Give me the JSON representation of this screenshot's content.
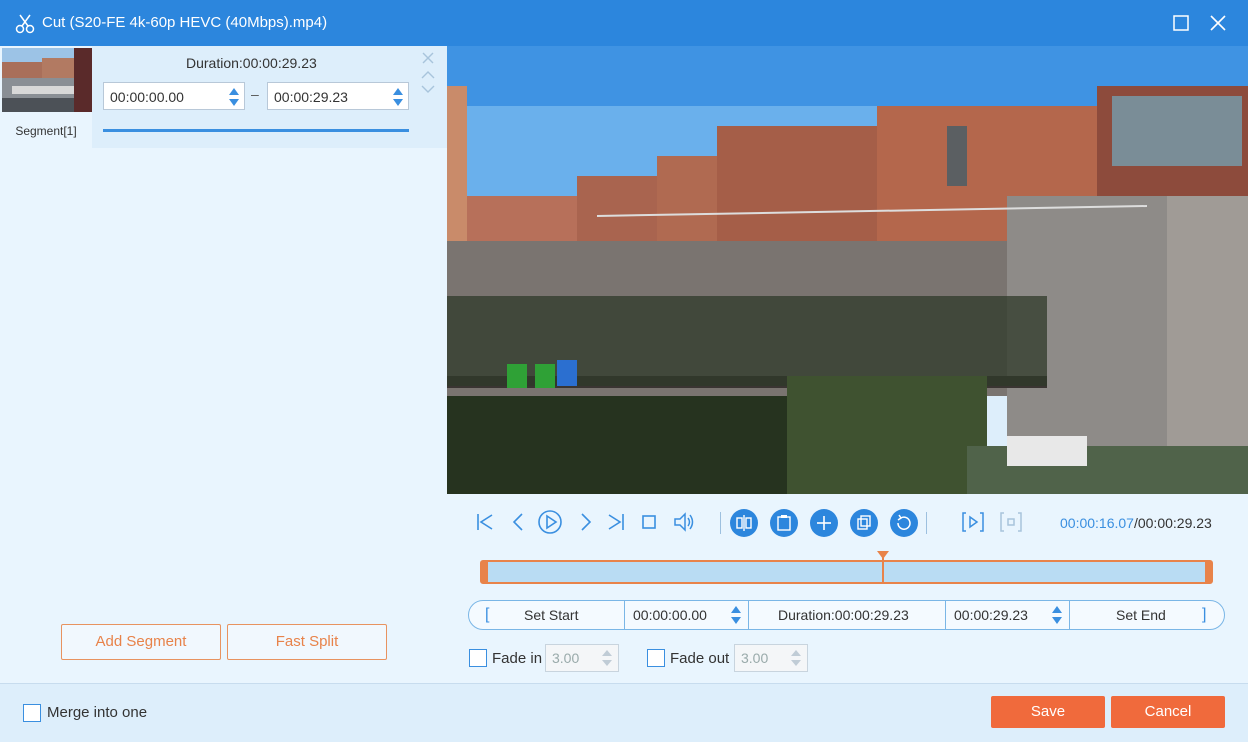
{
  "window": {
    "title": "Cut (S20-FE 4k-60p HEVC (40Mbps).mp4)"
  },
  "segment": {
    "label": "Segment[1]",
    "duration": "Duration:00:00:29.23",
    "start": "00:00:00.00",
    "end": "00:00:29.23",
    "dash": "–"
  },
  "left_buttons": {
    "add_segment": "Add Segment",
    "fast_split": "Fast Split"
  },
  "playback": {
    "current_time": "00:00:16.07",
    "total_time": "/00:00:29.23",
    "playhead_fraction": 0.55
  },
  "setbar": {
    "set_start": "Set Start",
    "start_time": "00:00:00.00",
    "duration": "Duration:00:00:29.23",
    "end_time": "00:00:29.23",
    "set_end": "Set End"
  },
  "fade": {
    "fade_in_label": "Fade in",
    "fade_in_value": "3.00",
    "fade_out_label": "Fade out",
    "fade_out_value": "3.00"
  },
  "footer": {
    "merge_label": "Merge into one",
    "save": "Save",
    "cancel": "Cancel"
  },
  "colors": {
    "titlebar": "#2c86dd",
    "accent_blue": "#3a8fe0",
    "accent_orange": "#f06a3c"
  }
}
